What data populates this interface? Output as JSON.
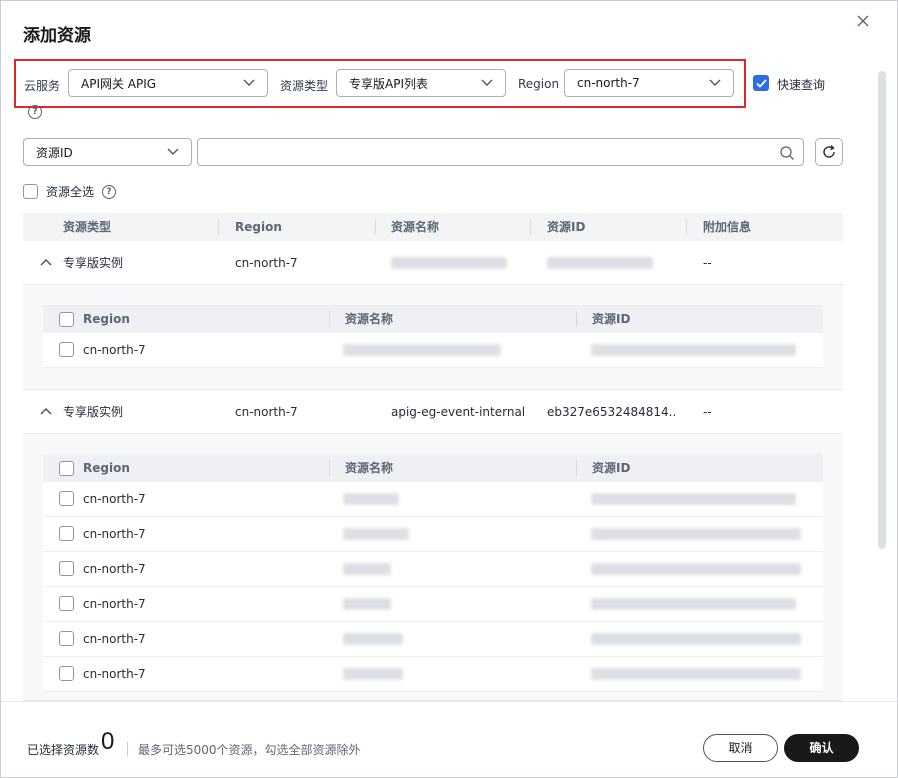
{
  "dialog": {
    "title": "添加资源"
  },
  "filters": {
    "service_label": "云服务",
    "service_value": "API网关 APIG",
    "type_label": "资源类型",
    "type_value": "专享版API列表",
    "region_label": "Region",
    "region_value": "cn-north-7",
    "quick_query_label": "快速查询"
  },
  "search": {
    "field_value": "资源ID",
    "select_all_label": "资源全选"
  },
  "table": {
    "columns": [
      "资源类型",
      "Region",
      "资源名称",
      "资源ID",
      "附加信息"
    ],
    "groups": [
      {
        "type": "专享版实例",
        "region": "cn-north-7",
        "name": "",
        "id": "",
        "extra": "--",
        "sub_columns": [
          "Region",
          "资源名称",
          "资源ID"
        ],
        "rows": [
          {
            "region": "cn-north-7"
          }
        ]
      },
      {
        "type": "专享版实例",
        "region": "cn-north-7",
        "name": "apig-eg-event-internal",
        "id": "eb327e6532484814...",
        "extra": "--",
        "sub_columns": [
          "Region",
          "资源名称",
          "资源ID"
        ],
        "rows": [
          {
            "region": "cn-north-7"
          },
          {
            "region": "cn-north-7"
          },
          {
            "region": "cn-north-7"
          },
          {
            "region": "cn-north-7"
          },
          {
            "region": "cn-north-7"
          },
          {
            "region": "cn-north-7"
          }
        ]
      }
    ]
  },
  "footer": {
    "selected_label": "已选择资源数",
    "selected_count": "0",
    "hint": "最多可选5000个资源，勾选全部资源除外",
    "cancel_label": "取消",
    "confirm_label": "确认"
  },
  "colors": {
    "accent": "#2c6de6",
    "highlight_border": "#e0262c",
    "primary_button": "#191919"
  }
}
